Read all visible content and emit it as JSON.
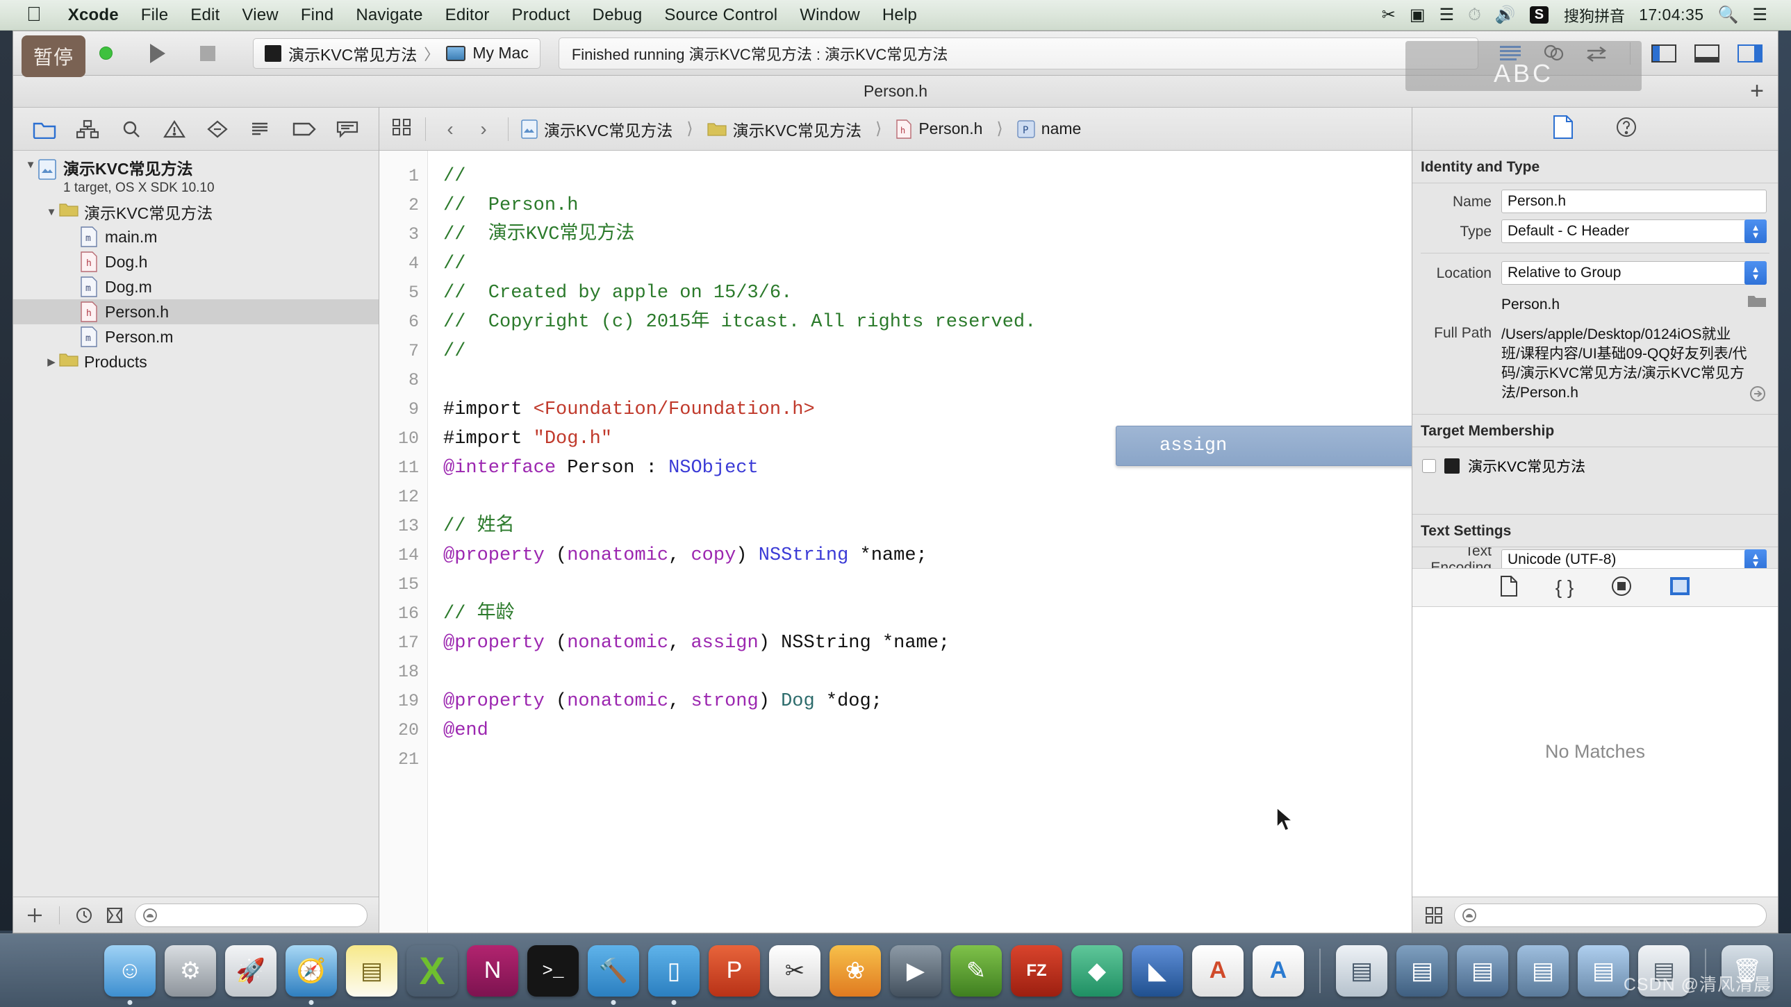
{
  "menubar": {
    "apple_icon": "apple-logo-icon",
    "items": [
      {
        "label": "Xcode",
        "bold": true
      },
      {
        "label": "File",
        "bold": false
      },
      {
        "label": "Edit",
        "bold": false
      },
      {
        "label": "View",
        "bold": false
      },
      {
        "label": "Find",
        "bold": false
      },
      {
        "label": "Navigate",
        "bold": false
      },
      {
        "label": "Editor",
        "bold": false
      },
      {
        "label": "Product",
        "bold": false
      },
      {
        "label": "Debug",
        "bold": false
      },
      {
        "label": "Source Control",
        "bold": false
      },
      {
        "label": "Window",
        "bold": false
      },
      {
        "label": "Help",
        "bold": false
      }
    ],
    "status_items": {
      "scissors_icon": "scissors-icon",
      "screenrecord_icon": "video-camera-icon",
      "audio_icon": "audio-waveform-icon",
      "timemachine_icon": "clock-icon",
      "volume_icon": "speaker-icon",
      "sogou_badge": "S",
      "sogou_label": "搜狗拼音",
      "clock": "17:04:35",
      "spotlight_icon": "search-icon",
      "notification_icon": "list-icon"
    }
  },
  "toolbar": {
    "pause_button_label": "暂停",
    "run_button": "run-icon",
    "stop_button": "stop-icon",
    "scheme_project": "演示KVC常见方法",
    "scheme_separator": "〉",
    "scheme_destination": "My Mac",
    "status_message": "Finished running 演示KVC常见方法 : 演示KVC常见方法",
    "tooltip_overlay_text": "ABC",
    "right_icons": [
      "editor-standard-icon",
      "editor-assistant-icon",
      "editor-version-icon",
      "view-navigator-icon",
      "view-debug-icon",
      "view-utilities-icon"
    ]
  },
  "title_strip": {
    "title": "Person.h",
    "add_tab_icon": "plus-icon"
  },
  "navigator": {
    "tabs": [
      "project-navigator-icon",
      "symbol-navigator-icon",
      "find-navigator-icon",
      "issue-navigator-icon",
      "test-navigator-icon",
      "debug-navigator-icon",
      "breakpoint-navigator-icon",
      "report-navigator-icon"
    ],
    "tree": [
      {
        "label": "演示KVC常见方法",
        "sub": "1 target, OS X SDK 10.10",
        "depth": 0,
        "kind": "project",
        "expanded": true,
        "selected": false
      },
      {
        "label": "演示KVC常见方法",
        "sub": "",
        "depth": 1,
        "kind": "folder",
        "expanded": true,
        "selected": false
      },
      {
        "label": "main.m",
        "sub": "",
        "depth": 2,
        "kind": "m",
        "expanded": null,
        "selected": false
      },
      {
        "label": "Dog.h",
        "sub": "",
        "depth": 2,
        "kind": "h",
        "expanded": null,
        "selected": false
      },
      {
        "label": "Dog.m",
        "sub": "",
        "depth": 2,
        "kind": "m",
        "expanded": null,
        "selected": false
      },
      {
        "label": "Person.h",
        "sub": "",
        "depth": 2,
        "kind": "h",
        "expanded": null,
        "selected": true
      },
      {
        "label": "Person.m",
        "sub": "",
        "depth": 2,
        "kind": "m",
        "expanded": null,
        "selected": false
      },
      {
        "label": "Products",
        "sub": "",
        "depth": 1,
        "kind": "folder",
        "expanded": false,
        "selected": false
      }
    ],
    "bottom": {
      "add_icon": "plus-icon",
      "recent_icon": "clock-icon",
      "sourcecontrol_icon": "filter-modified-icon",
      "filter_placeholder": ""
    }
  },
  "jumpbar": {
    "related_items_icon": "related-files-icon",
    "back_icon": "chevron-left-icon",
    "forward_icon": "chevron-right-icon",
    "crumbs": [
      {
        "label": "演示KVC常见方法",
        "icon": "project-icon"
      },
      {
        "label": "演示KVC常见方法",
        "icon": "folder-icon"
      },
      {
        "label": "Person.h",
        "icon": "header-file-icon"
      },
      {
        "label": "name",
        "icon": "property-icon"
      }
    ]
  },
  "editor": {
    "line_numbers": [
      "1",
      "2",
      "3",
      "4",
      "5",
      "6",
      "7",
      "8",
      "9",
      "10",
      "11",
      "12",
      "13",
      "14",
      "15",
      "16",
      "17",
      "18",
      "19",
      "20",
      "21"
    ],
    "lines": [
      {
        "n": 1,
        "text": "//"
      },
      {
        "n": 2,
        "text": "//  Person.h"
      },
      {
        "n": 3,
        "text": "//  演示KVC常见方法"
      },
      {
        "n": 4,
        "text": "//"
      },
      {
        "n": 5,
        "text": "//  Created by apple on 15/3/6."
      },
      {
        "n": 6,
        "text": "//  Copyright (c) 2015年 itcast. All rights reserved."
      },
      {
        "n": 7,
        "text": "//"
      },
      {
        "n": 8,
        "text": ""
      },
      {
        "n": 9,
        "text": "#import <Foundation/Foundation.h>"
      },
      {
        "n": 10,
        "text": "#import \"Dog.h\""
      },
      {
        "n": 11,
        "text": "@interface Person : NSObject"
      },
      {
        "n": 12,
        "text": ""
      },
      {
        "n": 13,
        "text": "// 姓名"
      },
      {
        "n": 14,
        "text": "@property (nonatomic, copy) NSString *name;"
      },
      {
        "n": 15,
        "text": ""
      },
      {
        "n": 16,
        "text": "// 年龄"
      },
      {
        "n": 17,
        "text": "@property (nonatomic, assign) NSString *name;"
      },
      {
        "n": 18,
        "text": ""
      },
      {
        "n": 19,
        "text": "@property (nonatomic, strong) Dog *dog;"
      },
      {
        "n": 20,
        "text": "@end"
      },
      {
        "n": 21,
        "text": ""
      }
    ],
    "autocomplete": {
      "visible": true,
      "selected_item": "assign"
    }
  },
  "inspector": {
    "tabs": [
      "file-inspector-icon",
      "quick-help-icon"
    ],
    "identity_and_type": {
      "header": "Identity and Type",
      "name_label": "Name",
      "name_value": "Person.h",
      "type_label": "Type",
      "type_value": "Default - C Header",
      "location_label": "Location",
      "location_value": "Relative to Group",
      "location_file": "Person.h",
      "folder_icon": "folder-icon",
      "fullpath_label": "Full Path",
      "fullpath_value": "/Users/apple/Desktop/0124iOS就业班/课程内容/UI基础09-QQ好友列表/代码/演示KVC常见方法/演示KVC常见方法/Person.h",
      "reveal_icon": "arrow-reveal-icon"
    },
    "target_membership": {
      "header": "Target Membership",
      "target_name": "演示KVC常见方法",
      "checked": false
    },
    "text_settings": {
      "header": "Text Settings",
      "encoding_label": "Text Encoding",
      "encoding_value": "Unicode (UTF-8)"
    },
    "library_icons": [
      "file-template-library-icon",
      "code-snippet-library-icon",
      "object-library-icon",
      "media-library-icon"
    ],
    "library_empty_message": "No Matches",
    "bottom": {
      "grid_icon": "grid-view-icon",
      "filter_placeholder": ""
    }
  },
  "dock": {
    "items": [
      {
        "name": "finder",
        "color": "#4fa8e0",
        "glyph": "☺"
      },
      {
        "name": "system-preferences",
        "color": "#9aa0a6",
        "glyph": "⚙"
      },
      {
        "name": "launchpad",
        "color": "#c8ccd0",
        "glyph": "🚀"
      },
      {
        "name": "safari",
        "color": "#2f8fd8",
        "glyph": "🧭"
      },
      {
        "name": "notes",
        "color": "#f6e27a",
        "glyph": "▤"
      },
      {
        "name": "xcode-alt",
        "color": "#6fbf2f",
        "glyph": "X"
      },
      {
        "name": "onenote",
        "color": "#a4176b",
        "glyph": "N"
      },
      {
        "name": "terminal",
        "color": "#151515",
        "glyph": ">_"
      },
      {
        "name": "xcode",
        "color": "#3f9ae0",
        "glyph": "🔨"
      },
      {
        "name": "simulator",
        "color": "#3f9ae0",
        "glyph": "▯"
      },
      {
        "name": "pycharm",
        "color": "#e2502b",
        "glyph": "P"
      },
      {
        "name": "snip-tool",
        "color": "#e8e8e8",
        "glyph": "✂"
      },
      {
        "name": "photos",
        "color": "#f0a030",
        "glyph": "❀"
      },
      {
        "name": "quicktime",
        "color": "#5b5b5b",
        "glyph": "▶"
      },
      {
        "name": "sublime",
        "color": "#4e9c3a",
        "glyph": "✎"
      },
      {
        "name": "filezilla",
        "color": "#c0392b",
        "glyph": "FZ"
      },
      {
        "name": "charles",
        "color": "#2f9e6f",
        "glyph": "◆"
      },
      {
        "name": "sketch",
        "color": "#2f5fb0",
        "glyph": "◣"
      },
      {
        "name": "pages",
        "color": "#f2f2f2",
        "glyph": "A"
      },
      {
        "name": "keynote",
        "color": "#f2f2f2",
        "glyph": "A"
      },
      {
        "name": "sep1",
        "color": "",
        "glyph": ""
      },
      {
        "name": "doc-stack-1",
        "color": "#cfd8e0",
        "glyph": "▤"
      },
      {
        "name": "doc-stack-2",
        "color": "#5e7da0",
        "glyph": "▤"
      },
      {
        "name": "downloads-1",
        "color": "#6d8fb0",
        "glyph": "▤"
      },
      {
        "name": "downloads-2",
        "color": "#7fa0c0",
        "glyph": "▤"
      },
      {
        "name": "downloads-3",
        "color": "#8fb0d0",
        "glyph": "▤"
      },
      {
        "name": "downloads-4",
        "color": "#d8dde2",
        "glyph": "▤"
      },
      {
        "name": "sep2",
        "color": "",
        "glyph": ""
      },
      {
        "name": "trash",
        "color": "#b8c4ce",
        "glyph": "🗑"
      }
    ]
  },
  "watermark": {
    "text": "CSDN @清风清晨"
  }
}
